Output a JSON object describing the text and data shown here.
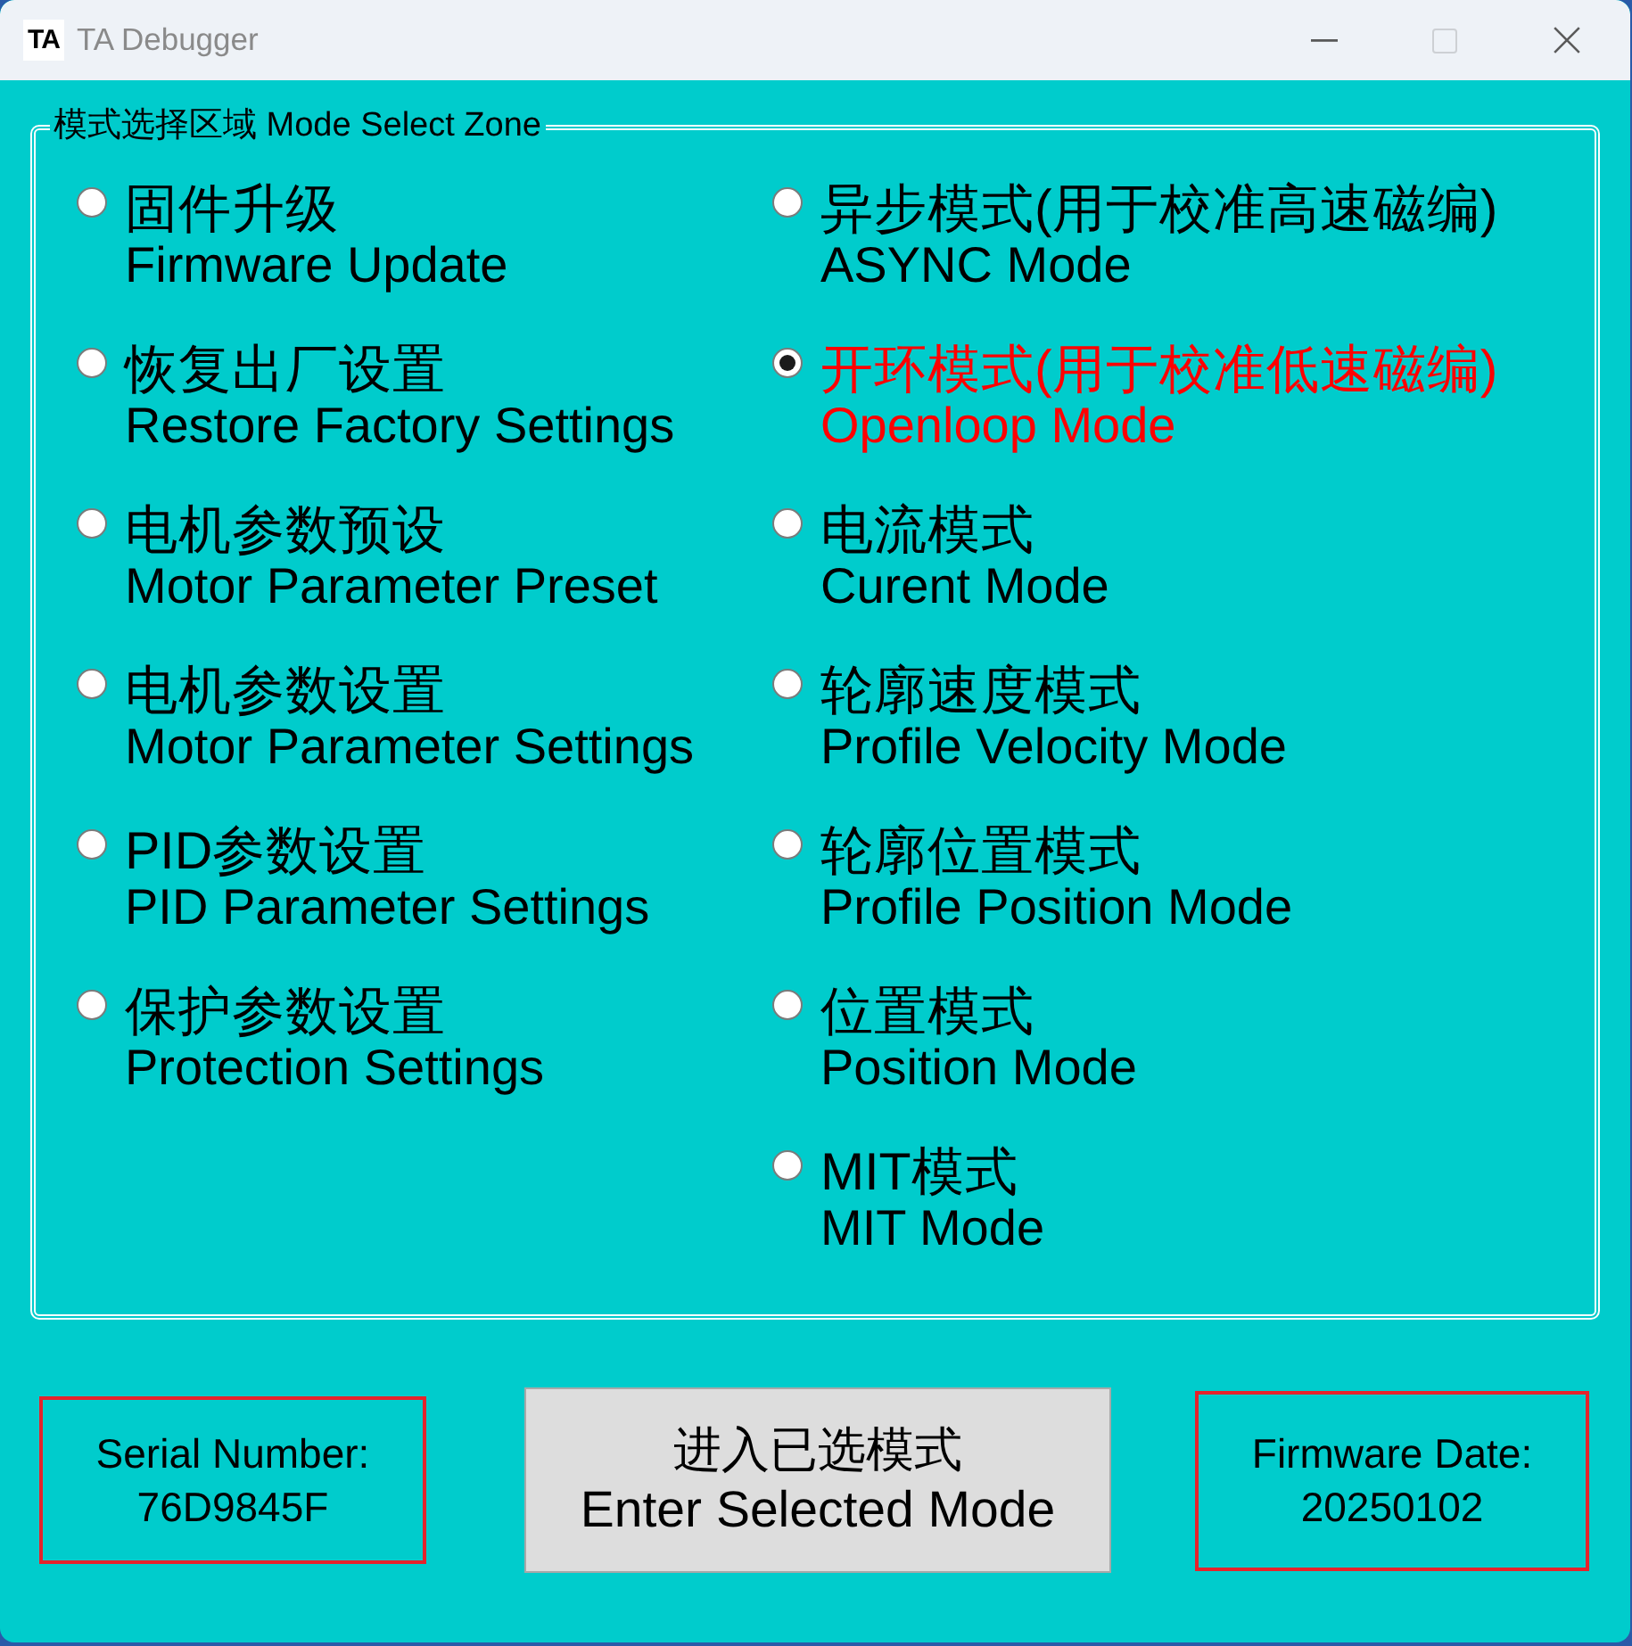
{
  "window": {
    "logo": "TA",
    "title": "TA Debugger",
    "controls": [
      {
        "kind": "minimize",
        "disabled": false
      },
      {
        "kind": "maximize",
        "disabled": true
      },
      {
        "kind": "close",
        "disabled": false
      }
    ]
  },
  "mode_zone": {
    "title": "模式选择区域 Mode Select Zone",
    "columns": [
      {
        "options": [
          {
            "label_cn": "固件升级",
            "label_en": "Firmware Update",
            "selected": false
          },
          {
            "label_cn": "恢复出厂设置",
            "label_en": "Restore Factory Settings",
            "selected": false
          },
          {
            "label_cn": "电机参数预设",
            "label_en": "Motor Parameter Preset",
            "selected": false
          },
          {
            "label_cn": "电机参数设置",
            "label_en": "Motor Parameter Settings",
            "selected": false
          },
          {
            "label_cn": "PID参数设置",
            "label_en": "PID Parameter Settings",
            "selected": false
          },
          {
            "label_cn": "保护参数设置",
            "label_en": "Protection Settings",
            "selected": false
          }
        ]
      },
      {
        "options": [
          {
            "label_cn": "异步模式(用于校准高速磁编)",
            "label_en": "ASYNC Mode",
            "selected": false
          },
          {
            "label_cn": "开环模式(用于校准低速磁编)",
            "label_en": "Openloop Mode",
            "selected": true
          },
          {
            "label_cn": "电流模式",
            "label_en": "Curent Mode",
            "selected": false
          },
          {
            "label_cn": "轮廓速度模式",
            "label_en": "Profile Velocity Mode",
            "selected": false
          },
          {
            "label_cn": "轮廓位置模式",
            "label_en": "Profile Position Mode",
            "selected": false
          },
          {
            "label_cn": "位置模式",
            "label_en": "Position Mode",
            "selected": false
          },
          {
            "label_cn": "MIT模式",
            "label_en": "MIT Mode",
            "selected": false
          }
        ]
      }
    ]
  },
  "serial_number": {
    "label": "Serial Number:",
    "value": "76D9845F"
  },
  "enter_button": {
    "label_cn": "进入已选模式",
    "label_en": "Enter Selected Mode"
  },
  "firmware_date": {
    "label": "Firmware Date:",
    "value": "20250102"
  }
}
